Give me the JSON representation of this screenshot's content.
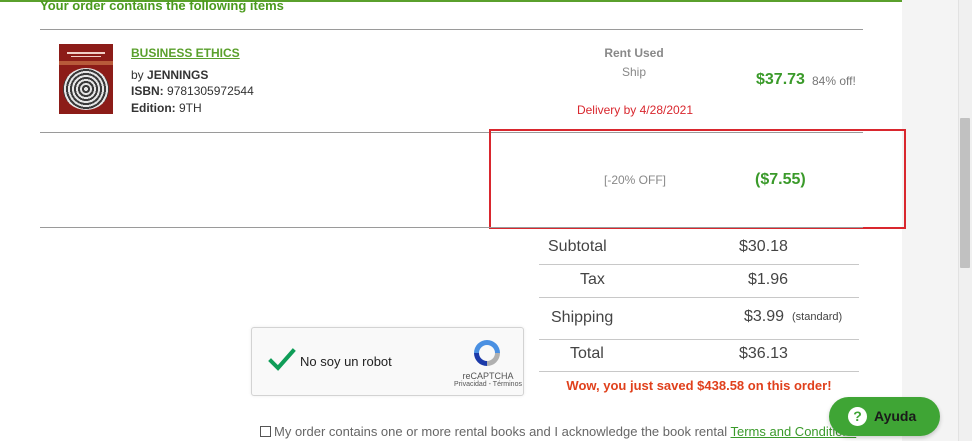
{
  "header": {
    "title": "Your order contains the following items"
  },
  "item": {
    "title": "BUSINESS ETHICS",
    "by_prefix": "by",
    "author": "JENNINGS",
    "isbn_label": "ISBN:",
    "isbn": "9781305972544",
    "edition_label": "Edition:",
    "edition": "9TH",
    "rent_type": "Rent Used",
    "ship_method": "Ship",
    "delivery": "Delivery by 4/28/2021",
    "price": "$37.73",
    "discount_off": "84% off!"
  },
  "coupon": {
    "label": "[-20% OFF]",
    "amount": "($7.55)"
  },
  "totals": {
    "subtotal_label": "Subtotal",
    "subtotal_value": "$30.18",
    "tax_label": "Tax",
    "tax_value": "$1.96",
    "shipping_label": "Shipping",
    "shipping_value": "$3.99",
    "shipping_note": "(standard)",
    "total_label": "Total",
    "total_value": "$36.13",
    "savings_message": "Wow, you just saved $438.58 on this order!"
  },
  "recaptcha": {
    "label": "No soy un robot",
    "brand": "reCAPTCHA",
    "links": "Privacidad - Términos"
  },
  "acknowledgement": {
    "text": "My order contains one or more rental books and I acknowledge the book rental",
    "link_text": "Terms and Conditions"
  },
  "help_button": {
    "label": "Ayuda",
    "icon": "question-icon"
  },
  "colors": {
    "accent": "#3fa535",
    "price": "#3a9a2a",
    "alert": "#d9272e",
    "savings": "#e0401c"
  }
}
